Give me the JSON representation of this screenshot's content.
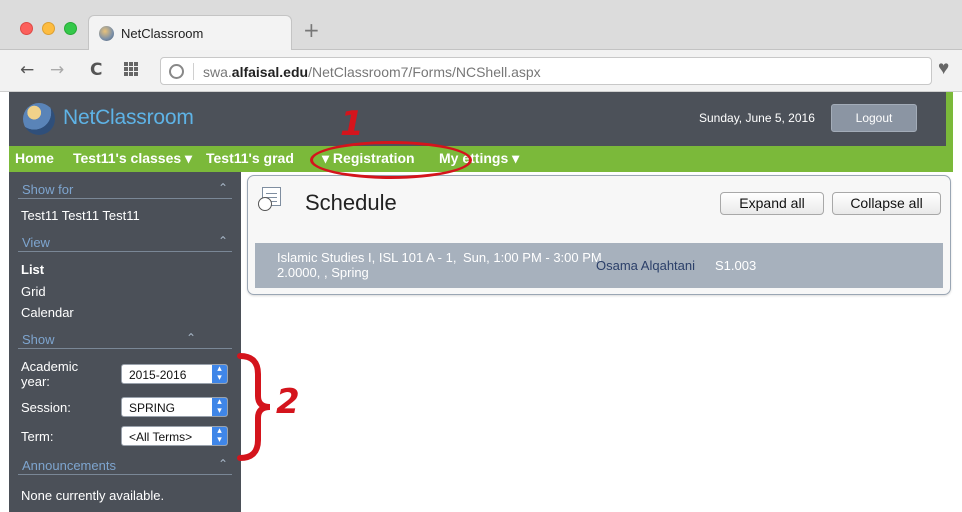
{
  "browser": {
    "tab_title": "NetClassroom",
    "new_tab": "+",
    "url_prefix": "swa.",
    "url_domain": "alfaisal.edu",
    "url_path": "/NetClassroom7/Forms/NCShell.aspx",
    "back": "←",
    "forward": "→",
    "reload": "C",
    "bookmark_icon": "♥"
  },
  "header": {
    "app_name": "NetClassroom",
    "date": "Sunday, June 5, 2016",
    "logout_label": "Logout",
    "accent_green": "#7bb93a",
    "header_dark": "#4c5159"
  },
  "menu": {
    "home": "Home",
    "classes": "Test11's classes ▾",
    "grades": "Test11's grad",
    "registration": "▾  Registration",
    "settings": "My ettings ▾"
  },
  "sidebar": {
    "show_for": {
      "title": "Show for",
      "chevron": "⌃",
      "value": "Test11 Test11 Test11"
    },
    "view": {
      "title": "View",
      "chevron": "⌃",
      "items": [
        "List",
        "Grid",
        "Calendar"
      ],
      "selected": "List"
    },
    "show": {
      "title": "Show",
      "chevron": "⌃",
      "academic_year_label": "Academic year:",
      "academic_year_value": "2015-2016",
      "session_label": "Session:",
      "session_value": "SPRING",
      "term_label": "Term:",
      "term_value": "<All Terms>"
    },
    "announcements": {
      "title": "Announcements",
      "chevron": "⌃",
      "text": "None currently available."
    }
  },
  "schedule": {
    "title": "Schedule",
    "expand_label": "Expand all",
    "collapse_label": "Collapse all",
    "rows": [
      {
        "course": "Islamic Studies I, ISL 101 A - 1, 2.0000, , Spring",
        "time": "Sun, 1:00 PM - 3:00 PM",
        "instructor": "Osama Alqahtani",
        "room": "S1.003"
      }
    ]
  },
  "annotations": {
    "marker_1": "1",
    "marker_2": "2",
    "color": "#d4141c"
  }
}
